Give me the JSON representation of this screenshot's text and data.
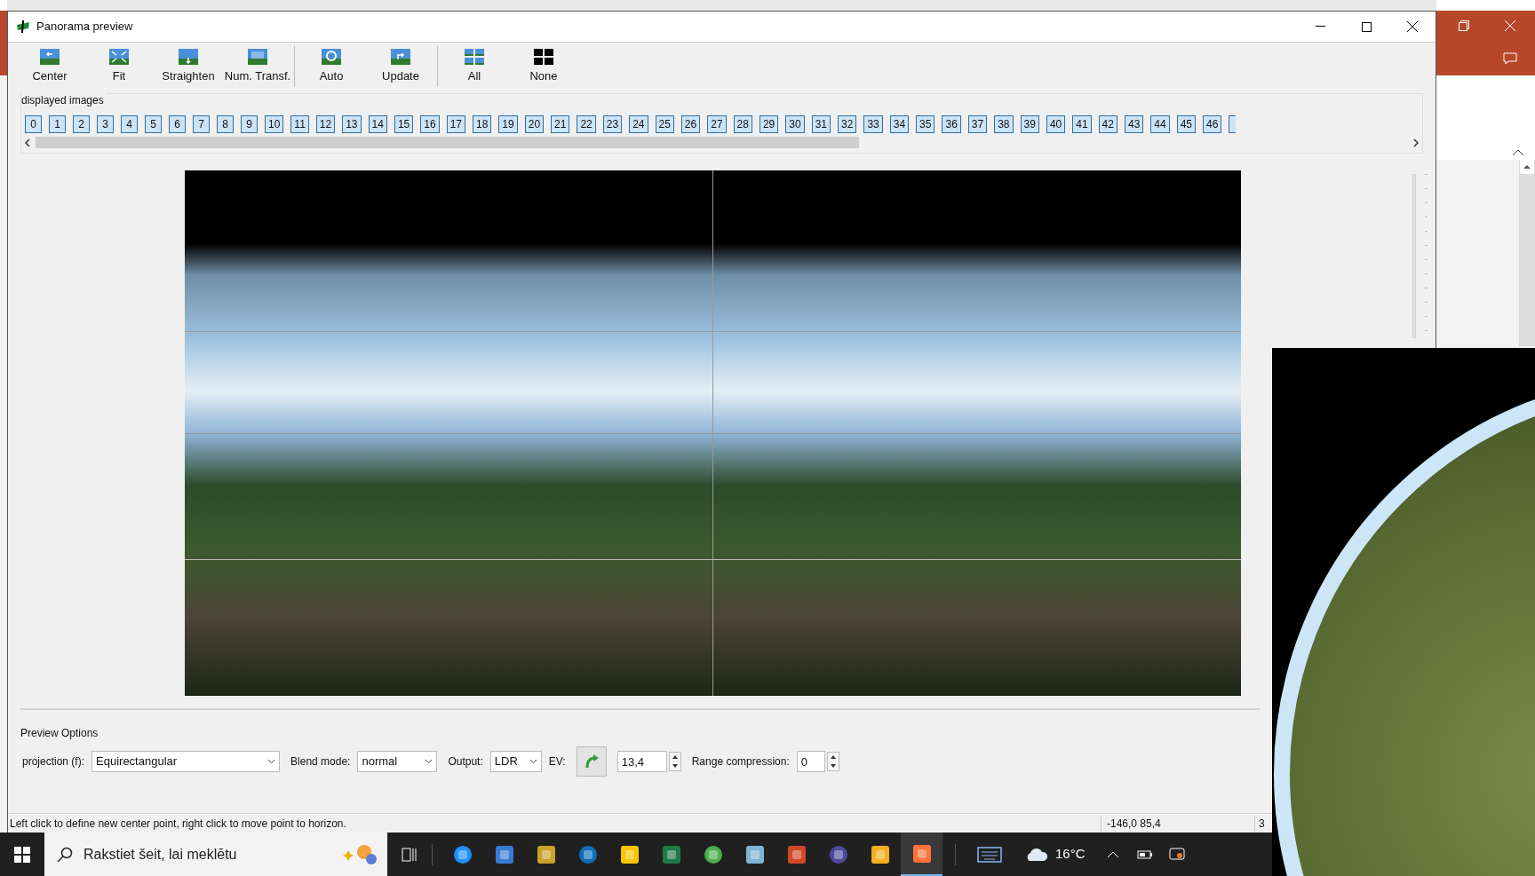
{
  "window": {
    "title": "Panorama preview"
  },
  "toolbar": [
    {
      "kind": "tool",
      "label": "Center"
    },
    {
      "kind": "tool",
      "label": "Fit"
    },
    {
      "kind": "tool",
      "label": "Straighten"
    },
    {
      "kind": "tool",
      "label": "Num. Transf."
    },
    {
      "kind": "separator"
    },
    {
      "kind": "tool",
      "label": "Auto"
    },
    {
      "kind": "tool",
      "label": "Update"
    },
    {
      "kind": "separator"
    },
    {
      "kind": "tool",
      "label": "All"
    },
    {
      "kind": "tool",
      "label": "None"
    }
  ],
  "displayed_images": {
    "title": "displayed images",
    "images": [
      {
        "label": "0",
        "selected": true
      },
      {
        "label": "1",
        "selected": true
      },
      {
        "label": "2",
        "selected": true
      },
      {
        "label": "3",
        "selected": true
      },
      {
        "label": "4",
        "selected": true
      },
      {
        "label": "5",
        "selected": true
      },
      {
        "label": "6",
        "selected": true
      },
      {
        "label": "7",
        "selected": true
      },
      {
        "label": "8",
        "selected": true
      },
      {
        "label": "9",
        "selected": true
      },
      {
        "label": "10",
        "selected": true
      },
      {
        "label": "11",
        "selected": true
      },
      {
        "label": "12",
        "selected": true
      },
      {
        "label": "13",
        "selected": true
      },
      {
        "label": "14",
        "selected": true
      },
      {
        "label": "15",
        "selected": true
      },
      {
        "label": "16",
        "selected": true
      },
      {
        "label": "17",
        "selected": true
      },
      {
        "label": "18",
        "selected": true
      },
      {
        "label": "19",
        "selected": true
      },
      {
        "label": "20",
        "selected": true
      },
      {
        "label": "21",
        "selected": true
      },
      {
        "label": "22",
        "selected": true
      },
      {
        "label": "23",
        "selected": true
      },
      {
        "label": "24",
        "selected": true
      },
      {
        "label": "25",
        "selected": true
      },
      {
        "label": "26",
        "selected": true
      },
      {
        "label": "27",
        "selected": true
      },
      {
        "label": "28",
        "selected": true
      },
      {
        "label": "29",
        "selected": true
      },
      {
        "label": "30",
        "selected": true
      },
      {
        "label": "31",
        "selected": true
      },
      {
        "label": "32",
        "selected": true
      },
      {
        "label": "33",
        "selected": true
      },
      {
        "label": "34",
        "selected": true
      },
      {
        "label": "35",
        "selected": true
      },
      {
        "label": "36",
        "selected": true
      },
      {
        "label": "37",
        "selected": true
      },
      {
        "label": "38",
        "selected": true
      },
      {
        "label": "39",
        "selected": true
      },
      {
        "label": "40",
        "selected": true
      },
      {
        "label": "41",
        "selected": true
      },
      {
        "label": "42",
        "selected": true
      },
      {
        "label": "43",
        "selected": true
      },
      {
        "label": "44",
        "selected": true
      },
      {
        "label": "45",
        "selected": true
      },
      {
        "label": "46",
        "selected": true
      }
    ]
  },
  "preview_options": {
    "title": "Preview Options",
    "projection_label": "projection (f):",
    "projection": "Equirectangular",
    "blend_label": "Blend mode:",
    "blend": "normal",
    "output_label": "Output:",
    "output": "LDR",
    "ev_label": "EV:",
    "ev": "13,4",
    "range_label": "Range compression:",
    "range": "0"
  },
  "status_bar": {
    "message": "Left click to define new center point, right click to move point to horizon.",
    "coordinates": "-146,0 85,4",
    "column_3": "3"
  },
  "taskbar": {
    "search_placeholder": "Rakstiet šeit, lai meklētu",
    "temperature": "16°C",
    "apps": [
      {
        "selected": false
      },
      {
        "selected": false
      },
      {
        "selected": false
      },
      {
        "selected": false
      },
      {
        "selected": false
      },
      {
        "selected": false
      },
      {
        "selected": false
      },
      {
        "selected": false
      },
      {
        "selected": false
      },
      {
        "selected": false
      },
      {
        "selected": false
      },
      {
        "selected": true
      }
    ]
  }
}
